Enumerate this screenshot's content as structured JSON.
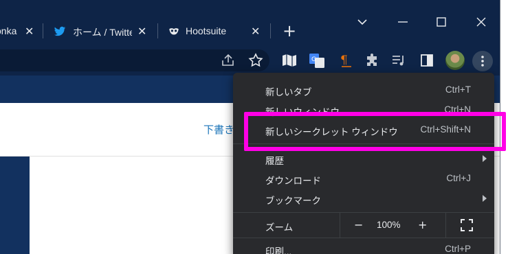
{
  "tabs": [
    {
      "label": "onka",
      "close": "✕"
    },
    {
      "label": "ホーム / Twitte",
      "close": "✕"
    },
    {
      "label": "Hootsuite",
      "close": "✕"
    }
  ],
  "new_tab_label": "+",
  "page": {
    "draft_link": "下書き"
  },
  "menu": {
    "items": [
      {
        "label": "新しいタブ",
        "shortcut": "Ctrl+T"
      },
      {
        "label": "新しいウィンドウ",
        "shortcut": "Ctrl+N"
      },
      {
        "label": "新しいシークレット ウィンドウ",
        "shortcut": "Ctrl+Shift+N"
      },
      {
        "label": "履歴",
        "shortcut": ""
      },
      {
        "label": "ダウンロード",
        "shortcut": "Ctrl+J"
      },
      {
        "label": "ブックマーク",
        "shortcut": ""
      },
      {
        "label": "印刷...",
        "shortcut": "Ctrl+P"
      }
    ],
    "zoom": {
      "label": "ズーム",
      "minus": "−",
      "value": "100%",
      "plus": "+"
    }
  },
  "colors": {
    "window_frame": "#0e2447",
    "menu_bg": "#292a2d",
    "highlight": "#ff00e6",
    "link": "#1a73b8"
  },
  "icons": [
    "twitter-bird-icon",
    "hootsuite-owl-icon",
    "share-icon",
    "star-icon",
    "reader-extension-icon",
    "translate-extension-icon",
    "paragraph-extension-icon",
    "puzzle-extensions-icon",
    "reading-list-icon",
    "side-panel-icon",
    "kebab-menu-icon",
    "fullscreen-icon"
  ]
}
